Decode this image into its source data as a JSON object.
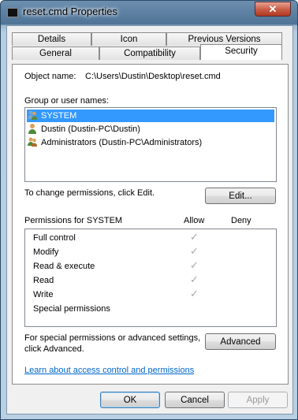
{
  "window": {
    "title": "reset.cmd Properties",
    "close_symbol": "✕"
  },
  "tabs": {
    "row1": [
      "Details",
      "Icon",
      "Previous Versions"
    ],
    "row2": [
      "General",
      "Compatibility",
      "Security"
    ],
    "active": "Security"
  },
  "object": {
    "label": "Object name:",
    "value": "C:\\Users\\Dustin\\Desktop\\reset.cmd"
  },
  "groups": {
    "label": "Group or user names:",
    "items": [
      {
        "name": "SYSTEM",
        "icon": "users-group-icon",
        "selected": true
      },
      {
        "name": "Dustin (Dustin-PC\\Dustin)",
        "icon": "user-icon",
        "selected": false
      },
      {
        "name": "Administrators (Dustin-PC\\Administrators)",
        "icon": "users-group-icon",
        "selected": false
      }
    ]
  },
  "change_text": "To change permissions, click Edit.",
  "edit_label": "Edit...",
  "permissions": {
    "header": "Permissions for SYSTEM",
    "allow_header": "Allow",
    "deny_header": "Deny",
    "items": [
      {
        "name": "Full control",
        "allow": true,
        "deny": false
      },
      {
        "name": "Modify",
        "allow": true,
        "deny": false
      },
      {
        "name": "Read & execute",
        "allow": true,
        "deny": false
      },
      {
        "name": "Read",
        "allow": true,
        "deny": false
      },
      {
        "name": "Write",
        "allow": true,
        "deny": false
      },
      {
        "name": "Special permissions",
        "allow": false,
        "deny": false
      }
    ],
    "check_symbol": "✓"
  },
  "advanced": {
    "text_line1": "For special permissions or advanced settings,",
    "text_line2": "click Advanced.",
    "button": "Advanced"
  },
  "link": "Learn about access control and permissions",
  "footer": {
    "ok": "OK",
    "cancel": "Cancel",
    "apply": "Apply"
  }
}
